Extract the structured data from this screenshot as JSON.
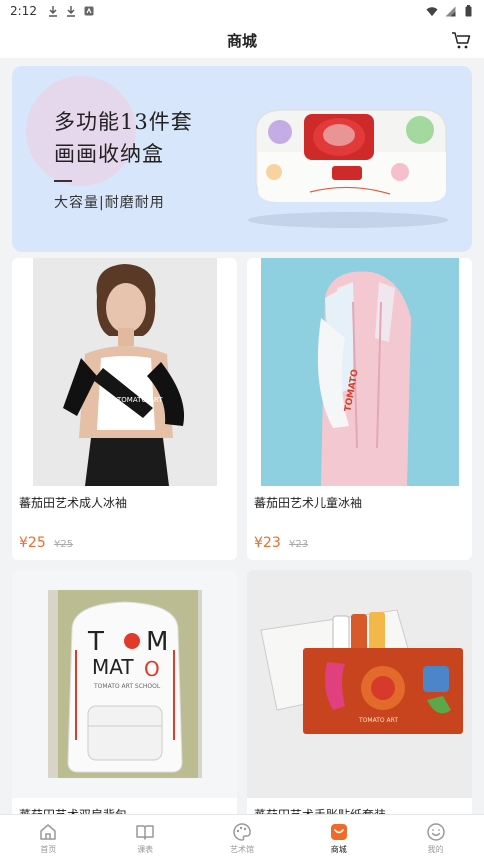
{
  "status_bar": {
    "time": "2:12"
  },
  "header": {
    "title": "商城"
  },
  "banner": {
    "line1": "多功能13件套",
    "line2": "画画收纳盒",
    "subtitle": "大容量|耐磨耐用"
  },
  "products": [
    {
      "name": "蕃茄田艺术成人冰袖",
      "price": "¥25",
      "old_price": "¥25"
    },
    {
      "name": "蕃茄田艺术儿童冰袖",
      "price": "¥23",
      "old_price": "¥23"
    },
    {
      "name": "蕃茄田艺术双肩背包"
    },
    {
      "name": "蕃茄田艺术手账贴纸套装"
    }
  ],
  "tabs": [
    {
      "label": "首页",
      "icon": "home-icon"
    },
    {
      "label": "课表",
      "icon": "book-icon"
    },
    {
      "label": "艺术馆",
      "icon": "palette-icon"
    },
    {
      "label": "商城",
      "icon": "shop-icon",
      "active": true
    },
    {
      "label": "我的",
      "icon": "smile-icon"
    }
  ],
  "colors": {
    "accent": "#f06a2a",
    "banner_bg": "#d8e6fb"
  }
}
